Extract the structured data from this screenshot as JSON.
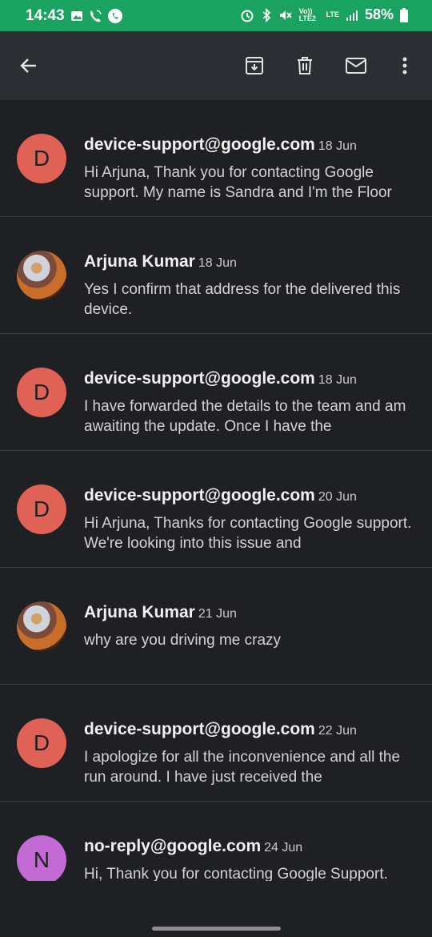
{
  "status_bar": {
    "time": "14:43",
    "volte_label": "Vo)) LTE2",
    "lte_label": "LTE",
    "battery": "58%"
  },
  "toolbar": {
    "icons": [
      "back-arrow-icon",
      "archive-icon",
      "delete-icon",
      "mail-icon",
      "more-vert-icon"
    ]
  },
  "messages": [
    {
      "sender": "device-support@google.com",
      "date": "18 Jun",
      "avatar_letter": "D",
      "avatar_color": "#e06155",
      "snippet": "Hi Arjuna, Thank you for contacting Google support. My name is Sandra and I'm the Floor"
    },
    {
      "sender": "Arjuna Kumar",
      "date": "18 Jun",
      "avatar_letter": "",
      "avatar_color": "photo",
      "snippet": "Yes I confirm that address for the delivered this device."
    },
    {
      "sender": "device-support@google.com",
      "date": "18 Jun",
      "avatar_letter": "D",
      "avatar_color": "#e06155",
      "snippet": "I have forwarded the details to the team and am awaiting the update. Once I have the"
    },
    {
      "sender": "device-support@google.com",
      "date": "20 Jun",
      "avatar_letter": "D",
      "avatar_color": "#e06155",
      "snippet": "Hi Arjuna, Thanks for contacting Google support. We're looking into this issue and"
    },
    {
      "sender": "Arjuna Kumar",
      "date": "21 Jun",
      "avatar_letter": "",
      "avatar_color": "photo",
      "snippet": "why are you driving me crazy"
    },
    {
      "sender": "device-support@google.com",
      "date": "22 Jun",
      "avatar_letter": "D",
      "avatar_color": "#e06155",
      "snippet": "I apologize for all the inconvenience and all the run around. I have just received the"
    },
    {
      "sender": "no-reply@google.com",
      "date": "24 Jun",
      "avatar_letter": "N",
      "avatar_color": "#c36ad4",
      "snippet": "Hi, Thank you for contacting Google Support."
    }
  ]
}
